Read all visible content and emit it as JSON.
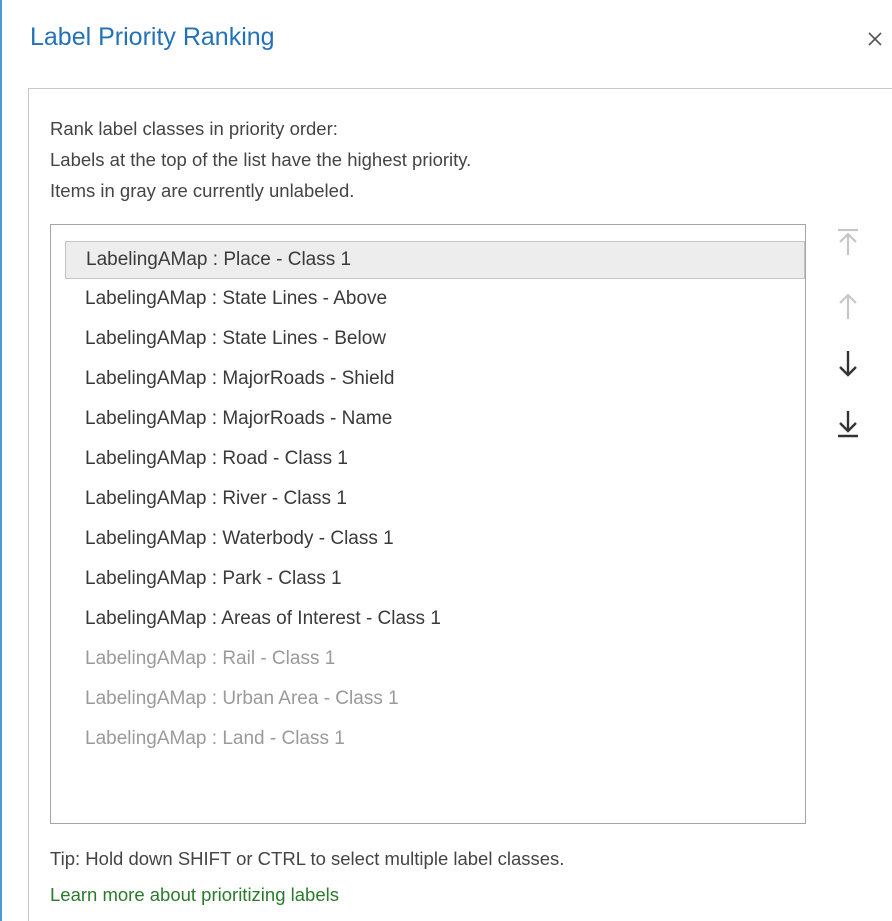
{
  "dialog": {
    "title": "Label Priority Ranking",
    "close_icon": "close-icon"
  },
  "instructions": [
    "Rank label classes in priority order:",
    "Labels at the top of the list have the highest priority.",
    "Items in gray are currently unlabeled."
  ],
  "list": {
    "items": [
      {
        "label": "LabelingAMap : Place - Class 1",
        "selected": true,
        "unlabeled": false
      },
      {
        "label": "LabelingAMap : State Lines - Above",
        "selected": false,
        "unlabeled": false
      },
      {
        "label": "LabelingAMap : State Lines - Below",
        "selected": false,
        "unlabeled": false
      },
      {
        "label": "LabelingAMap : MajorRoads - Shield",
        "selected": false,
        "unlabeled": false
      },
      {
        "label": "LabelingAMap : MajorRoads - Name",
        "selected": false,
        "unlabeled": false
      },
      {
        "label": "LabelingAMap : Road - Class 1",
        "selected": false,
        "unlabeled": false
      },
      {
        "label": "LabelingAMap : River - Class 1",
        "selected": false,
        "unlabeled": false
      },
      {
        "label": "LabelingAMap : Waterbody - Class 1",
        "selected": false,
        "unlabeled": false
      },
      {
        "label": "LabelingAMap : Park - Class 1",
        "selected": false,
        "unlabeled": false
      },
      {
        "label": "LabelingAMap : Areas of Interest - Class 1",
        "selected": false,
        "unlabeled": false
      },
      {
        "label": "LabelingAMap : Rail - Class 1",
        "selected": false,
        "unlabeled": true
      },
      {
        "label": "LabelingAMap : Urban Area - Class 1",
        "selected": false,
        "unlabeled": true
      },
      {
        "label": "LabelingAMap : Land - Class 1",
        "selected": false,
        "unlabeled": true
      }
    ]
  },
  "side_buttons": {
    "move_to_top": {
      "icon": "move-to-top-icon",
      "enabled": false
    },
    "move_up": {
      "icon": "arrow-up-icon",
      "enabled": false
    },
    "move_down": {
      "icon": "arrow-down-icon",
      "enabled": true
    },
    "move_to_bottom": {
      "icon": "move-to-bottom-icon",
      "enabled": true
    }
  },
  "footer": {
    "tip": "Tip: Hold down SHIFT or CTRL to select multiple label classes.",
    "learn_more_link": "Learn more about prioritizing labels"
  },
  "colors": {
    "title": "#2372b8",
    "window_border": "#4a9ad4",
    "link": "#2b7a2b",
    "unlabeled_text": "#9a9a9a",
    "selected_row": "#ededed",
    "disabled_icon": "#c6c6c6",
    "enabled_icon": "#333333"
  }
}
